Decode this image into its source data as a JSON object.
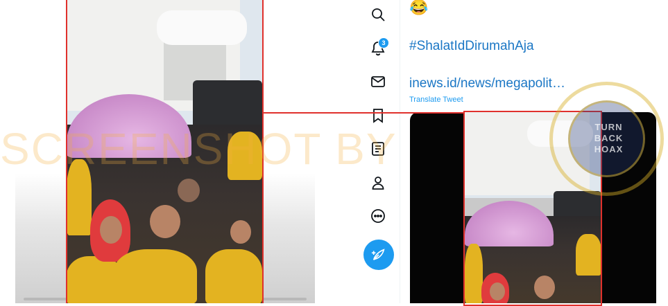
{
  "tweet": {
    "emoji": "😂",
    "hashtag": "#ShalatIdDirumahAja",
    "link": "inews.id/news/megapolit…",
    "translate_label": "Translate Tweet"
  },
  "sidebar": {
    "items": [
      {
        "name": "explore",
        "icon": "search-icon"
      },
      {
        "name": "notifications",
        "icon": "bell-icon"
      },
      {
        "name": "messages",
        "icon": "mail-icon"
      },
      {
        "name": "bookmarks",
        "icon": "bookmark-icon"
      },
      {
        "name": "lists",
        "icon": "list-icon"
      },
      {
        "name": "profile",
        "icon": "profile-icon"
      },
      {
        "name": "more",
        "icon": "more-icon"
      }
    ],
    "notification_count": "3",
    "compose_icon": "compose-tweet-icon"
  },
  "watermark": {
    "text": "SCREENSHOT BY",
    "seal_line1": "TURN",
    "seal_line2": "BACK",
    "seal_line3": "HOAX"
  },
  "colors": {
    "accent": "#1d9bf0",
    "link": "#1b77c5",
    "highlight_box": "#e0302c"
  }
}
